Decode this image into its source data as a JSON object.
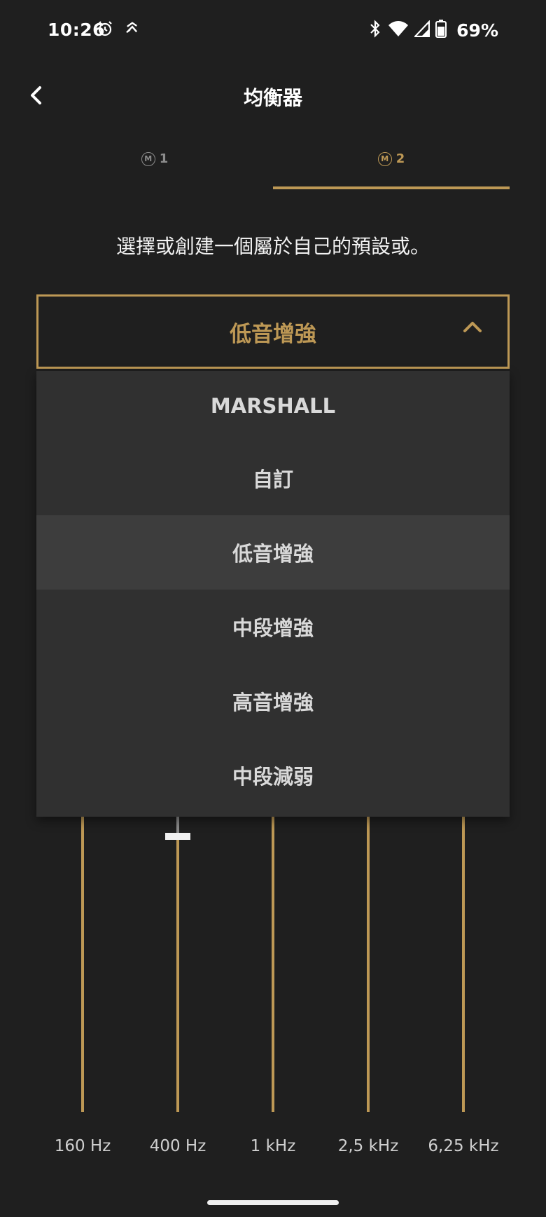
{
  "status_bar": {
    "time": "10:26",
    "battery": "69%",
    "icons": [
      "alarm-icon",
      "fitness-icon",
      "bluetooth-icon",
      "wifi-icon",
      "cell-signal-icon",
      "battery-icon"
    ]
  },
  "header": {
    "title": "均衡器",
    "back_icon": "chevron-left-icon"
  },
  "tabs": [
    {
      "badge": "M",
      "label": "1",
      "active": false
    },
    {
      "badge": "M",
      "label": "2",
      "active": true
    }
  ],
  "instruction": "選擇或創建一個屬於自己的預設或。",
  "preset": {
    "selected": "低音增強",
    "expanded": true,
    "options": [
      "MARSHALL",
      "自訂",
      "低音增強",
      "中段增強",
      "高音增強",
      "中段減弱"
    ],
    "highlighted_index": 2
  },
  "equalizer": {
    "bands": [
      {
        "label": "160 Hz"
      },
      {
        "label": "400 Hz"
      },
      {
        "label": "1 kHz"
      },
      {
        "label": "2,5 kHz"
      },
      {
        "label": "6,25 kHz"
      }
    ]
  },
  "colors": {
    "accent": "#bd9855",
    "background": "#1f1f1f",
    "dropdown": "#303030",
    "dropdown_highlight": "#3d3d3d"
  }
}
